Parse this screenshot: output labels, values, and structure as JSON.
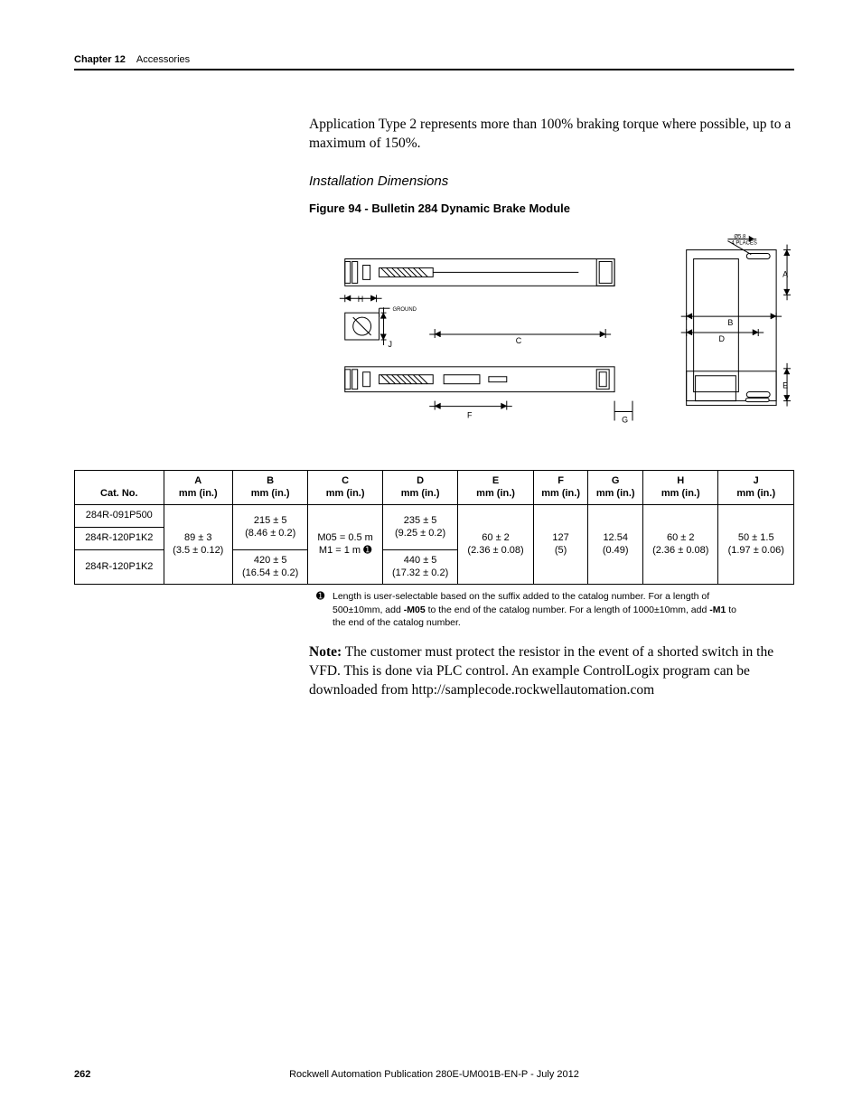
{
  "header": {
    "chapter_label": "Chapter 12",
    "chapter_title": "Accessories"
  },
  "para1": "Application Type 2 represents more than 100% braking torque where possible, up to a maximum of 150%.",
  "subheading": "Installation Dimensions",
  "figure_caption": "Figure 94 - Bulletin 284 Dynamic Brake Module",
  "diagram_labels": {
    "H": "H",
    "J": "J",
    "F": "F",
    "C": "C",
    "G": "G",
    "B": "B",
    "D": "D",
    "A": "A",
    "E": "E",
    "ground": "GROUND",
    "holes": "Ø5.8\n4 PLACES"
  },
  "table": {
    "headers": [
      {
        "letter": "",
        "unit": "Cat. No."
      },
      {
        "letter": "A",
        "unit": "mm (in.)"
      },
      {
        "letter": "B",
        "unit": "mm (in.)"
      },
      {
        "letter": "C",
        "unit": "mm (in.)"
      },
      {
        "letter": "D",
        "unit": "mm (in.)"
      },
      {
        "letter": "E",
        "unit": "mm (in.)"
      },
      {
        "letter": "F",
        "unit": "mm (in.)"
      },
      {
        "letter": "G",
        "unit": "mm (in.)"
      },
      {
        "letter": "H",
        "unit": "mm (in.)"
      },
      {
        "letter": "J",
        "unit": "mm (in.)"
      }
    ],
    "rows": {
      "cat1": "284R-091P500",
      "cat2": "284R-120P1K2",
      "cat3": "284R-120P1K2",
      "A": "89 ± 3\n(3.5 ± 0.12)",
      "B1": "215 ± 5\n(8.46 ± 0.2)",
      "B2": "420 ± 5\n(16.54 ± 0.2)",
      "C": "M05 = 0.5 m\nM1 = 1 m ➊",
      "D1": "235 ± 5\n(9.25 ± 0.2)",
      "D2": "440 ± 5\n(17.32 ± 0.2)",
      "E": "60 ± 2\n(2.36 ± 0.08)",
      "F": "127\n(5)",
      "G": "12.54\n(0.49)",
      "H": "60 ± 2\n(2.36 ± 0.08)",
      "J": "50 ± 1.5\n(1.97 ± 0.06)"
    }
  },
  "footnote": {
    "mark": "➊",
    "text_a": "Length is user-selectable based on the suffix added to the catalog number. For a length of 500±10mm, add ",
    "bold_a": "-M05",
    "text_b": " to the end of the catalog number. For a length of 1000±10mm, add ",
    "bold_b": "-M1",
    "text_c": " to the end of the catalog number."
  },
  "note": {
    "lead": "Note:",
    "text": " The customer must protect the resistor in the event of a shorted switch in the VFD. This is done via PLC control. An example ControlLogix program can be downloaded from http://samplecode.rockwellautomation.com"
  },
  "footer": {
    "page": "262",
    "pub": "Rockwell Automation Publication 280E-UM001B-EN-P - July 2012"
  },
  "chart_data": {
    "type": "table",
    "title": "Bulletin 284 Dynamic Brake Module — Installation Dimensions",
    "columns": [
      "Cat. No.",
      "A mm (in.)",
      "B mm (in.)",
      "C mm (in.)",
      "D mm (in.)",
      "E mm (in.)",
      "F mm (in.)",
      "G mm (in.)",
      "H mm (in.)",
      "J mm (in.)"
    ],
    "rows": [
      [
        "284R-091P500",
        "89 ± 3 (3.5 ± 0.12)",
        "215 ± 5 (8.46 ± 0.2)",
        "M05 = 0.5 m / M1 = 1 m",
        "235 ± 5 (9.25 ± 0.2)",
        "60 ± 2 (2.36 ± 0.08)",
        "127 (5)",
        "12.54 (0.49)",
        "60 ± 2 (2.36 ± 0.08)",
        "50 ± 1.5 (1.97 ± 0.06)"
      ],
      [
        "284R-120P1K2",
        "89 ± 3 (3.5 ± 0.12)",
        "215 ± 5 (8.46 ± 0.2)",
        "M05 = 0.5 m / M1 = 1 m",
        "235 ± 5 (9.25 ± 0.2)",
        "60 ± 2 (2.36 ± 0.08)",
        "127 (5)",
        "12.54 (0.49)",
        "60 ± 2 (2.36 ± 0.08)",
        "50 ± 1.5 (1.97 ± 0.06)"
      ],
      [
        "284R-120P1K2",
        "89 ± 3 (3.5 ± 0.12)",
        "420 ± 5 (16.54 ± 0.2)",
        "M05 = 0.5 m / M1 = 1 m",
        "440 ± 5 (17.32 ± 0.2)",
        "60 ± 2 (2.36 ± 0.08)",
        "127 (5)",
        "12.54 (0.49)",
        "60 ± 2 (2.36 ± 0.08)",
        "50 ± 1.5 (1.97 ± 0.06)"
      ]
    ]
  }
}
